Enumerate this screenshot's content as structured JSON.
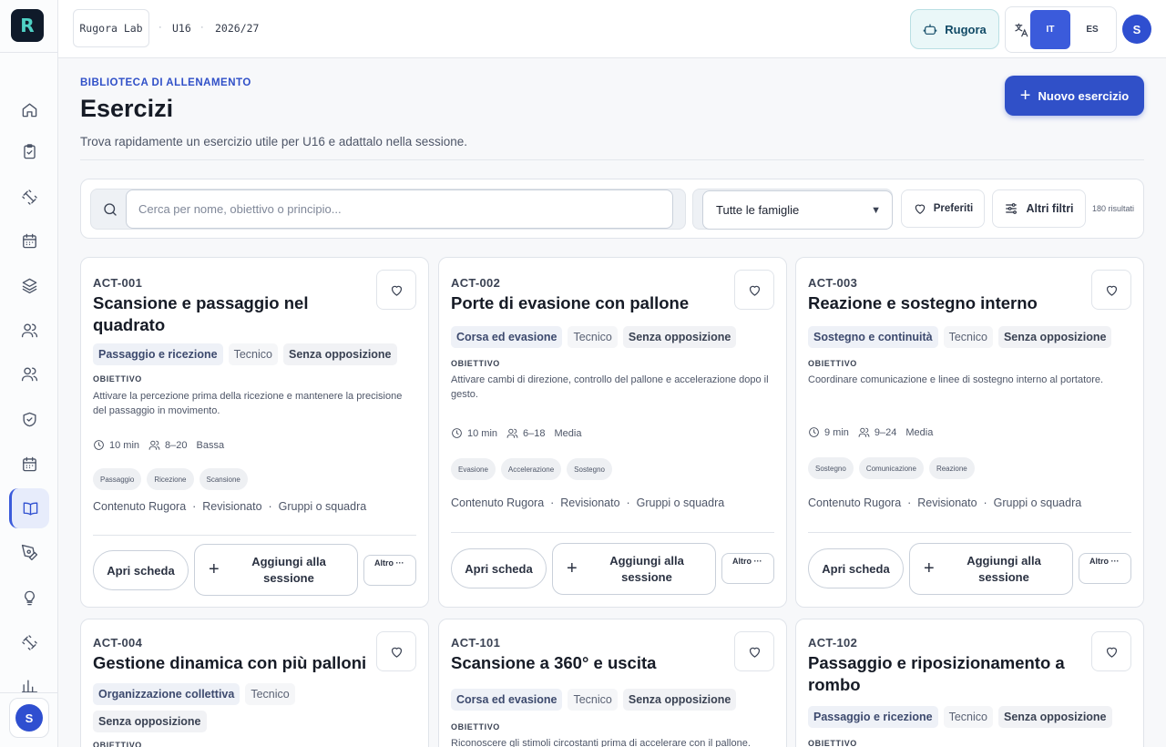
{
  "app": {
    "logo_letter": "R"
  },
  "topbar": {
    "club": "Rugora Lab",
    "team": "U16",
    "season": "2026/27",
    "separator": "·",
    "assistant_label": "Rugora",
    "languages": [
      "IT",
      "ES"
    ],
    "active_language": "IT",
    "user_initial": "S"
  },
  "header": {
    "eyebrow": "BIBLIOTECA DI ALLENAMENTO",
    "title": "Esercizi",
    "subtitle": "Trova rapidamente un esercizio utile per U16 e adattalo nella sessione.",
    "new_button": "Nuovo esercizio"
  },
  "filters": {
    "search_placeholder": "Cerca per nome, obiettivo o principio...",
    "search_value": "",
    "family_select": "Tutte le famiglie",
    "favorites_label": "Preferiti",
    "more_filters_label": "Altri filtri",
    "results_count": "180 risultati"
  },
  "card_labels": {
    "objective": "OBIETTIVO",
    "open": "Apri scheda",
    "add": "Aggiungi alla sessione",
    "more": "Altro ···"
  },
  "cards": [
    {
      "code": "ACT-001",
      "title": "Scansione e passaggio nel quadrato",
      "family": "Passaggio e ricezione",
      "type": "Tecnico",
      "opposition": "Senza opposizione",
      "objective": "Attivare la percezione prima della ricezione e mantenere la precisione del passaggio in movimento.",
      "duration": "10 min",
      "players": "8–20",
      "intensity": "Bassa",
      "principles": [
        "Passaggio",
        "Ricezione",
        "Scansione"
      ],
      "source": "Contenuto Rugora",
      "status": "Revisionato",
      "format": "Gruppi o squadra"
    },
    {
      "code": "ACT-002",
      "title": "Porte di evasione con pallone",
      "family": "Corsa ed evasione",
      "type": "Tecnico",
      "opposition": "Senza opposizione",
      "objective": "Attivare cambi di direzione, controllo del pallone e accelerazione dopo il gesto.",
      "duration": "10 min",
      "players": "6–18",
      "intensity": "Media",
      "principles": [
        "Evasione",
        "Accelerazione",
        "Sostegno"
      ],
      "source": "Contenuto Rugora",
      "status": "Revisionato",
      "format": "Gruppi o squadra"
    },
    {
      "code": "ACT-003",
      "title": "Reazione e sostegno interno",
      "family": "Sostegno e continuità",
      "type": "Tecnico",
      "opposition": "Senza opposizione",
      "objective": "Coordinare comunicazione e linee di sostegno interno al portatore.",
      "duration": "9 min",
      "players": "9–24",
      "intensity": "Media",
      "principles": [
        "Sostegno",
        "Comunicazione",
        "Reazione"
      ],
      "source": "Contenuto Rugora",
      "status": "Revisionato",
      "format": "Gruppi o squadra"
    },
    {
      "code": "ACT-004",
      "title": "Gestione dinamica con più palloni",
      "family": "Organizzazione collettiva",
      "type": "Tecnico",
      "opposition": "Senza opposizione",
      "objective": ""
    },
    {
      "code": "ACT-101",
      "title": "Scansione a 360° e uscita",
      "family": "Corsa ed evasione",
      "type": "Tecnico",
      "opposition": "Senza opposizione",
      "objective": "Riconoscere gli stimoli circostanti prima di accelerare con il pallone."
    },
    {
      "code": "ACT-102",
      "title": "Passaggio e riposizionamento a rombo",
      "family": "Passaggio e ricezione",
      "type": "Tecnico",
      "opposition": "Senza opposizione",
      "objective": ""
    }
  ]
}
